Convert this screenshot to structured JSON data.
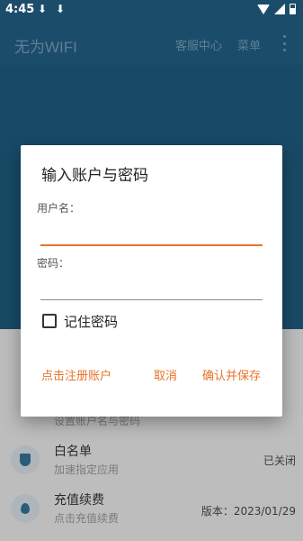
{
  "status_bar": {
    "time": "4:45",
    "icons": [
      "download-icon",
      "download-icon",
      "wifi-icon",
      "signal-icon",
      "battery-icon"
    ]
  },
  "app_bar": {
    "title": "无为WIFI",
    "menu_service": "客服中心",
    "menu_menu": "菜单"
  },
  "background_list": {
    "obscured_subtitle": "设置账户名与密码",
    "items": [
      {
        "title": "白名单",
        "subtitle": "加速指定应用",
        "right": "已关闭",
        "icon": "shield-icon"
      },
      {
        "title": "充值续费",
        "subtitle": "点击充值续费",
        "right": "版本：2023/01/29",
        "icon": "drop-icon"
      }
    ]
  },
  "dialog": {
    "title": "输入账户与密码",
    "username_label": "用户名：",
    "username_value": "",
    "password_label": "密码：",
    "password_value": "",
    "remember_label": "记住密码",
    "remember_checked": false,
    "register_label": "点击注册账户",
    "cancel_label": "取消",
    "confirm_label": "确认并保存"
  },
  "colors": {
    "accent": "#e8742a",
    "primary": "#1b4d6b"
  }
}
